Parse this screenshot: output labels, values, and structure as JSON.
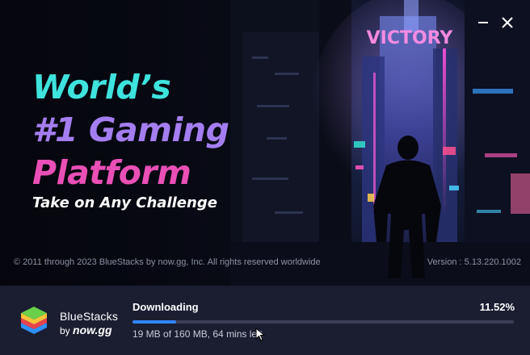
{
  "window": {
    "minimize_icon": "minimize-icon",
    "close_icon": "close-icon"
  },
  "hero": {
    "headline": [
      "World’s",
      "#1 Gaming",
      "Platform"
    ],
    "tagline": "Take on Any Challenge",
    "sign_text": "VICTORY",
    "copyright": "© 2011 through 2023 BlueStacks by now.gg, Inc. All rights reserved worldwide",
    "version": "Version : 5.13.220.1002"
  },
  "footer": {
    "brand_name": "BlueStacks",
    "brand_by": "by",
    "brand_now": "now.gg",
    "status": "Downloading",
    "percent_label": "11.52%",
    "progress_fraction": 0.1152,
    "detail": "19 MB of 160 MB, 64 mins left"
  },
  "colors": {
    "accent": "#2f86ff",
    "headline_cyan": "#3ee3dd",
    "headline_purple": "#a47ef0",
    "headline_pink": "#ea4fb6",
    "footer_bg": "#1b1e31"
  }
}
